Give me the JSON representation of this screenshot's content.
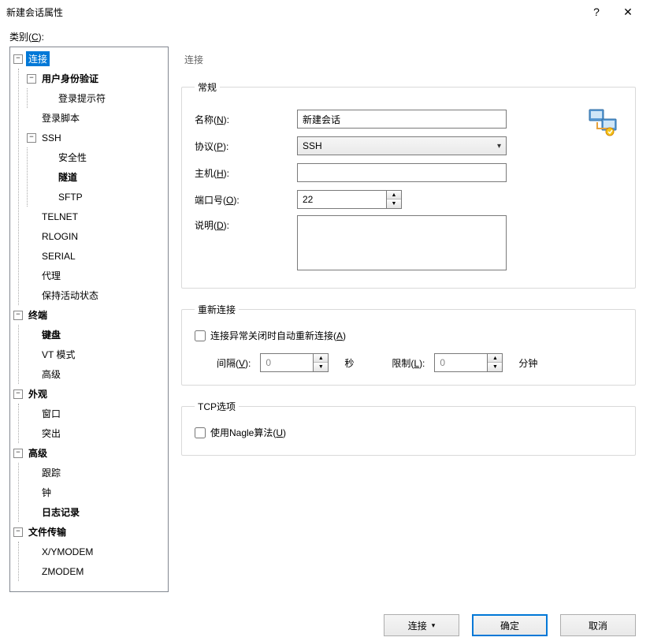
{
  "titlebar": {
    "title": "新建会话属性",
    "help": "?",
    "close": "✕"
  },
  "category_label": "类别(C):",
  "tree": {
    "connection": "连接",
    "user_auth": "用户身份验证",
    "login_prompt": "登录提示符",
    "login_script": "登录脚本",
    "ssh": "SSH",
    "security": "安全性",
    "tunnel": "隧道",
    "sftp": "SFTP",
    "telnet": "TELNET",
    "rlogin": "RLOGIN",
    "serial": "SERIAL",
    "proxy": "代理",
    "keepalive": "保持活动状态",
    "terminal": "终端",
    "keyboard": "键盘",
    "vt": "VT 模式",
    "advanced_t": "高级",
    "appearance": "外观",
    "window": "窗口",
    "highlight": "突出",
    "advanced": "高级",
    "trace": "跟踪",
    "bell": "钟",
    "logging": "日志记录",
    "file": "文件传输",
    "xymodem": "X/YMODEM",
    "zmodem": "ZMODEM"
  },
  "panel": {
    "header": "连接",
    "group_general": "常规",
    "name_label": "名称(N):",
    "name_value": "新建会话",
    "protocol_label": "协议(P):",
    "protocol_value": "SSH",
    "host_label": "主机(H):",
    "host_value": "",
    "port_label": "端口号(O):",
    "port_value": "22",
    "desc_label": "说明(D):",
    "desc_value": "",
    "group_reconnect": "重新连接",
    "auto_reconnect_label": "连接异常关闭时自动重新连接(A)",
    "interval_label": "间隔(V):",
    "interval_value": "0",
    "seconds": "秒",
    "limit_label": "限制(L):",
    "limit_value": "0",
    "minutes": "分钟",
    "group_tcp": "TCP选项",
    "nagle_label": "使用Nagle算法(U)"
  },
  "footer": {
    "connect": "连接",
    "ok": "确定",
    "cancel": "取消"
  }
}
